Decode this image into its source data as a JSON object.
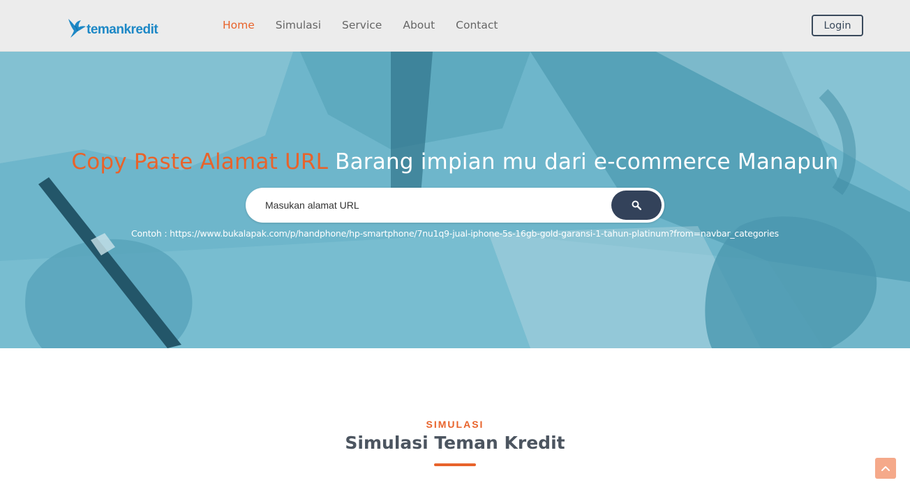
{
  "header": {
    "logo_text": "temankredit",
    "logo_icon": "bird-icon",
    "nav": [
      {
        "label": "Home",
        "active": true
      },
      {
        "label": "Simulasi",
        "active": false
      },
      {
        "label": "Service",
        "active": false
      },
      {
        "label": "About",
        "active": false
      },
      {
        "label": "Contact",
        "active": false
      }
    ],
    "login_label": "Login"
  },
  "hero": {
    "title_accent": "Copy Paste Alamat URL",
    "title_rest": " Barang impian mu dari e-commerce Manapun",
    "search_placeholder": "Masukan alamat URL",
    "search_icon": "search-icon",
    "example": "Contoh : https://www.bukalapak.com/p/handphone/hp-smartphone/7nu1q9-jual-iphone-5s-16gb-gold-garansi-1-tahun-platinum?from=navbar_categories"
  },
  "section": {
    "label": "SIMULASI",
    "title": "Simulasi Teman Kredit"
  },
  "back_to_top_icon": "chevron-up-icon",
  "colors": {
    "accent": "#e8632b",
    "primary_dark": "#33425a",
    "logo_blue": "#1d88c6",
    "hero_tint": "#6fb8cd"
  }
}
